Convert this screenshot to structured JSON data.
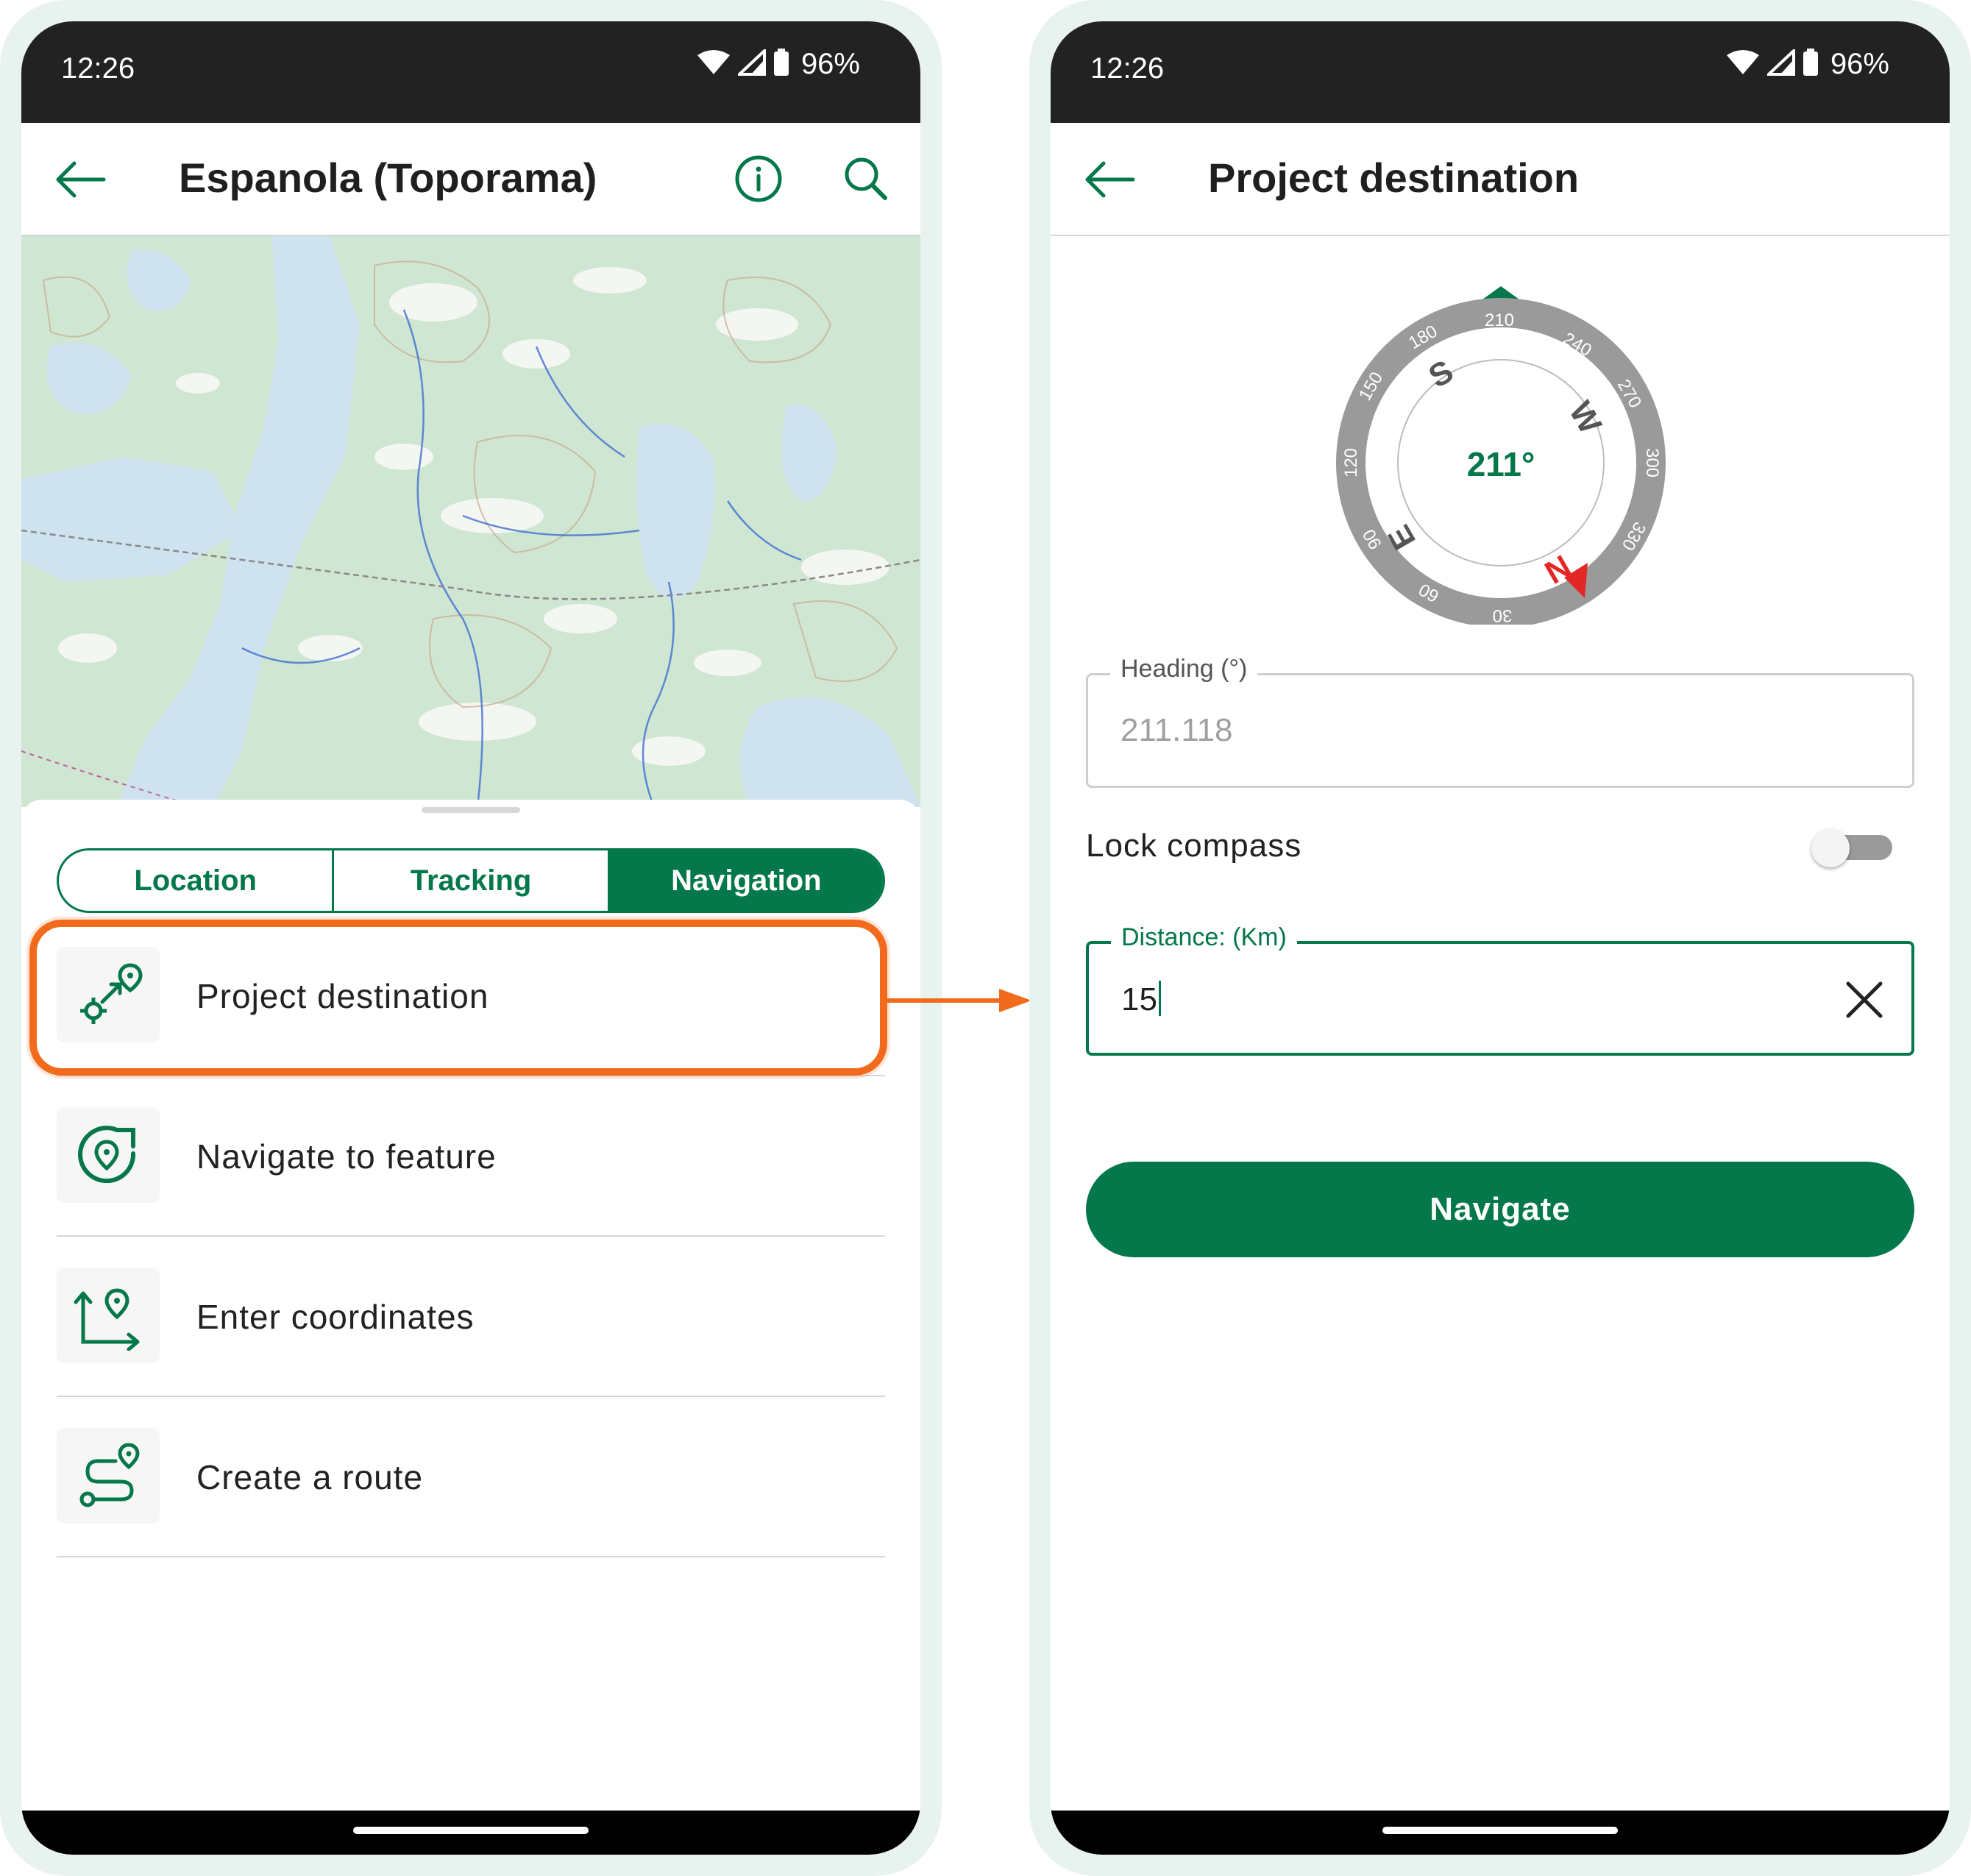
{
  "colors": {
    "brand": "#04784a",
    "highlight": "#f26b1d",
    "needle": "#e32626"
  },
  "left": {
    "status": {
      "time": "12:26",
      "battery": "96%"
    },
    "appbar": {
      "title": "Espanola (Toporama)"
    },
    "tabs": [
      "Location",
      "Tracking",
      "Navigation"
    ],
    "active_tab": "Navigation",
    "menu": [
      {
        "label": "Project destination",
        "icon": "project-destination-icon"
      },
      {
        "label": "Navigate to feature",
        "icon": "navigate-feature-icon"
      },
      {
        "label": "Enter coordinates",
        "icon": "enter-coordinates-icon"
      },
      {
        "label": "Create a route",
        "icon": "create-route-icon"
      }
    ]
  },
  "right": {
    "status": {
      "time": "12:26",
      "battery": "96%"
    },
    "appbar": {
      "title": "Project destination"
    },
    "compass": {
      "heading_display": "211°",
      "cardinals": {
        "n": "N",
        "e": "E",
        "s": "S",
        "w": "W"
      },
      "ticks": [
        "210",
        "240",
        "270",
        "300",
        "330",
        "30",
        "60",
        "90",
        "120",
        "150",
        "180"
      ]
    },
    "heading": {
      "label": "Heading (°)",
      "value": "211.118"
    },
    "lock_compass": {
      "label": "Lock compass",
      "on": false
    },
    "distance": {
      "label": "Distance: (Km)",
      "value": "15"
    },
    "navigate_label": "Navigate"
  }
}
